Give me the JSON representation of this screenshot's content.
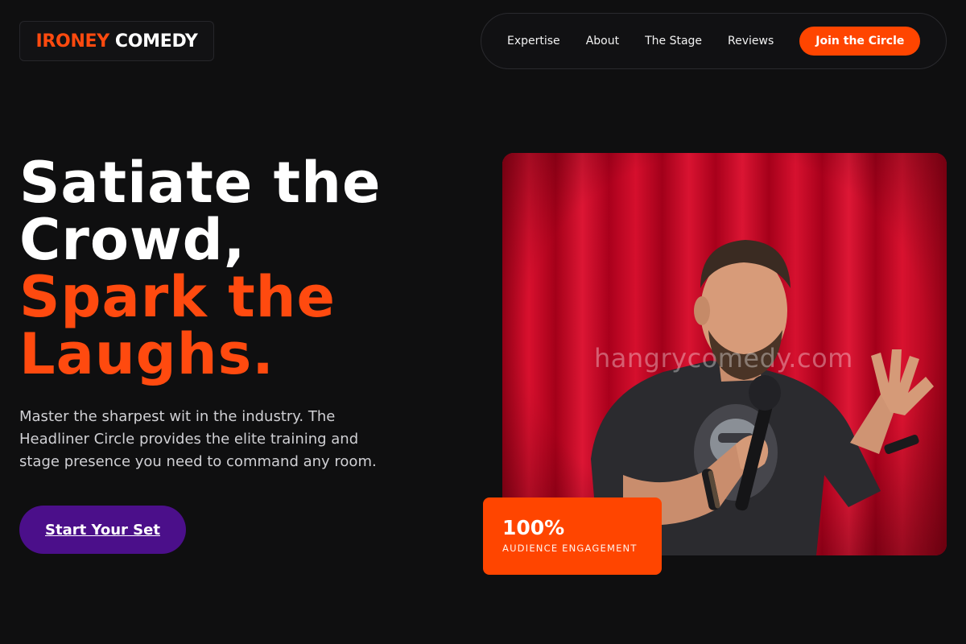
{
  "brand": {
    "accent_word": "IRONEY",
    "rest_word": "COMEDY",
    "accent_color": "#ff4a0f"
  },
  "nav": {
    "items": [
      {
        "label": "Expertise"
      },
      {
        "label": "About"
      },
      {
        "label": "The Stage"
      },
      {
        "label": "Reviews"
      }
    ],
    "cta_label": "Join the Circle",
    "cta_color": "#ff4500"
  },
  "hero": {
    "headline_white": [
      "Satiate the",
      "Crowd,"
    ],
    "headline_orange": [
      "Spark the",
      "Laughs."
    ],
    "subtext": "Master the sharpest wit in the industry. The Headliner Circle provides the elite training and stage presence you need to command any room.",
    "primary_button": "Start Your Set",
    "primary_button_color": "#4b0f8a"
  },
  "image": {
    "alt": "Comedian performing with microphone in front of red curtain",
    "watermark": "hangrycomedy.com"
  },
  "stat": {
    "value": "100%",
    "label": "AUDIENCE ENGAGEMENT"
  }
}
